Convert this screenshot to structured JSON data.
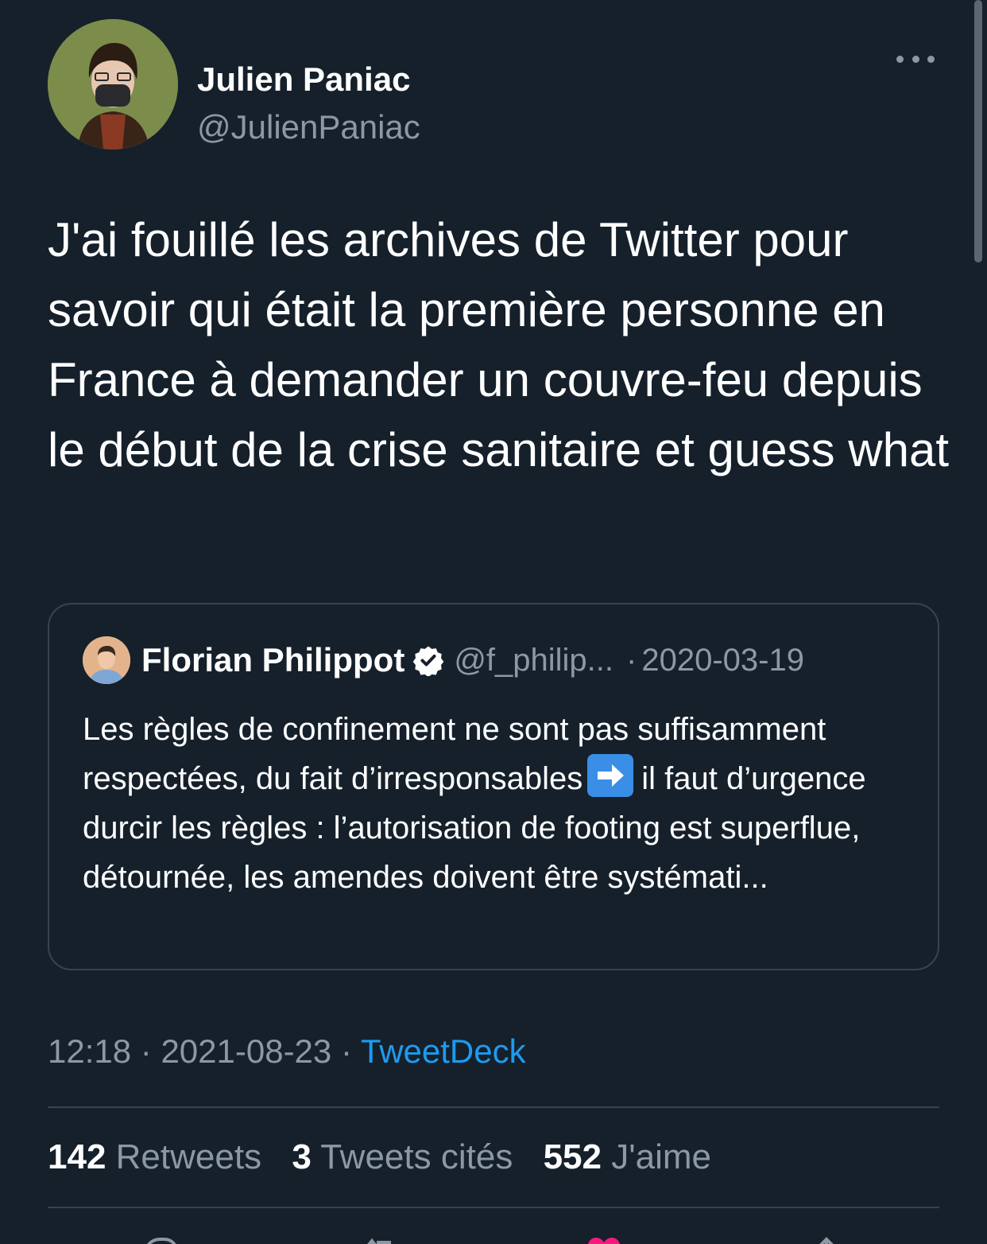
{
  "author": {
    "name": "Julien Paniac",
    "handle": "@JulienPaniac"
  },
  "tweet": {
    "text": "J'ai fouillé les archives de Twitter pour savoir qui était la première personne en France à demander un couvre-feu depuis le début de la crise sanitaire et guess what"
  },
  "quote": {
    "name": "Florian Philippot",
    "handle": "@f_philip...",
    "separator": "·",
    "date": "2020-03-19",
    "text_before": "Les règles de confinement ne sont pas suffisamment respectées, du fait d’irresponsables",
    "text_after": "il faut d’urgence durcir les règles : l’autorisation de footing est superflue, détournée, les amendes doivent être systémati..."
  },
  "meta": {
    "time": "12:18",
    "sep1": " · ",
    "date": "2021-08-23",
    "sep2": " · ",
    "source": "TweetDeck"
  },
  "stats": {
    "retweets_count": "142",
    "retweets_label": "Retweets",
    "quotes_count": "3",
    "quotes_label": "Tweets cités",
    "likes_count": "552",
    "likes_label": "J'aime"
  },
  "colors": {
    "background": "#15202b",
    "accent": "#1d9bf0",
    "secondary_text": "#8b98a5",
    "border": "#38444d"
  },
  "icons": [
    "more-icon",
    "verified-icon",
    "arrow-right-emoji",
    "reply-icon",
    "retweet-icon",
    "like-icon",
    "share-icon"
  ]
}
